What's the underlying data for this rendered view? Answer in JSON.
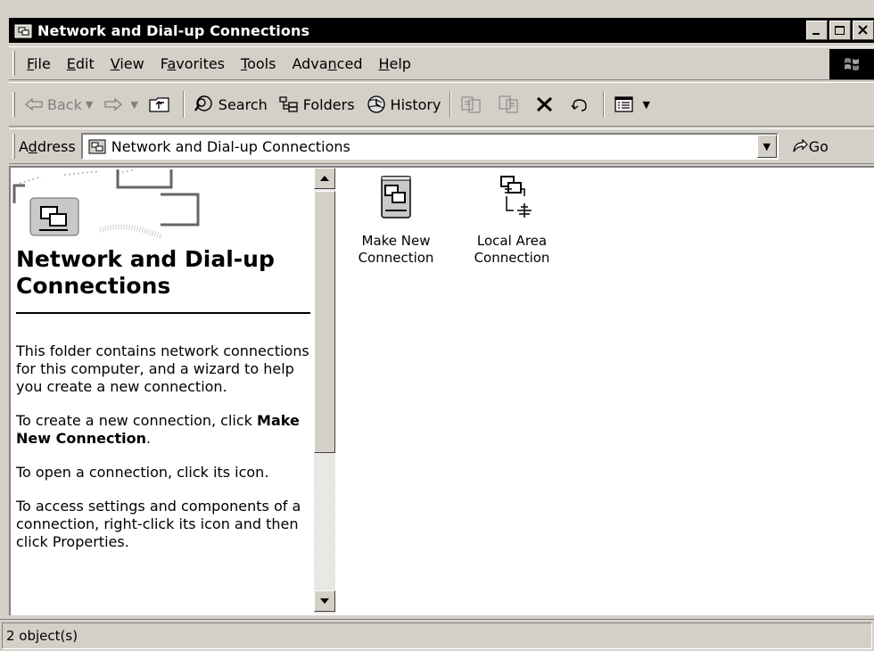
{
  "window": {
    "title": "Network and Dial-up Connections"
  },
  "menu": [
    {
      "label": "File",
      "accel": "F"
    },
    {
      "label": "Edit",
      "accel": "E"
    },
    {
      "label": "View",
      "accel": "V"
    },
    {
      "label": "Favorites",
      "accel": "a"
    },
    {
      "label": "Tools",
      "accel": "T"
    },
    {
      "label": "Advanced",
      "accel": "n"
    },
    {
      "label": "Help",
      "accel": "H"
    }
  ],
  "toolbar": {
    "back": "Back",
    "search": "Search",
    "folders": "Folders",
    "history": "History"
  },
  "address": {
    "label": "Address",
    "value": "Network and Dial-up Connections",
    "go": "Go"
  },
  "left_pane": {
    "title": "Network and Dial-up Connections",
    "para1": "This folder contains network connections for this computer, and a wizard to help you create a new connection.",
    "para2_prefix": "To create a new connection, click ",
    "para2_bold": "Make New Connection",
    "para2_suffix": ".",
    "para3": "To open a connection, click its icon.",
    "para4": "To access settings and components of a connection, right-click its icon and then click Properties."
  },
  "items": [
    {
      "label_line1": "Make New",
      "label_line2": "Connection",
      "icon": "make-new-connection-icon"
    },
    {
      "label_line1": "Local Area",
      "label_line2": "Connection",
      "icon": "local-area-connection-icon"
    }
  ],
  "status": {
    "text": "2 object(s)"
  }
}
